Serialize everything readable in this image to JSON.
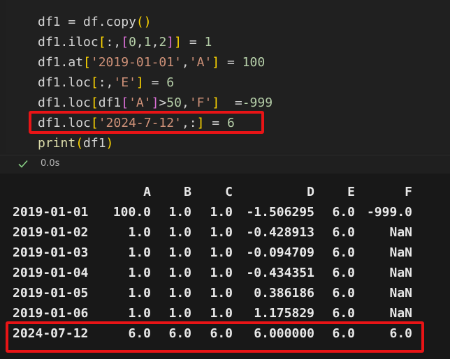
{
  "code": {
    "lines": [
      [
        [
          "df1",
          "tk-plain"
        ],
        [
          " = ",
          "tk-op"
        ],
        [
          "df",
          "tk-plain"
        ],
        [
          ".copy",
          "tk-plain"
        ],
        [
          "(",
          "tk-b1"
        ],
        [
          ")",
          "tk-b1"
        ]
      ],
      [
        [
          "df1",
          "tk-plain"
        ],
        [
          ".iloc",
          "tk-plain"
        ],
        [
          "[",
          "tk-b1"
        ],
        [
          ":,",
          "tk-plain"
        ],
        [
          "[",
          "tk-b2"
        ],
        [
          "0",
          "tk-num"
        ],
        [
          ",",
          "tk-plain"
        ],
        [
          "1",
          "tk-num"
        ],
        [
          ",",
          "tk-plain"
        ],
        [
          "2",
          "tk-num"
        ],
        [
          "]",
          "tk-b2"
        ],
        [
          "]",
          "tk-b1"
        ],
        [
          " = ",
          "tk-op"
        ],
        [
          "1",
          "tk-num"
        ]
      ],
      [
        [
          "df1",
          "tk-plain"
        ],
        [
          ".at",
          "tk-plain"
        ],
        [
          "[",
          "tk-b1"
        ],
        [
          "'2019-01-01'",
          "tk-str"
        ],
        [
          ",",
          "tk-plain"
        ],
        [
          "'A'",
          "tk-str"
        ],
        [
          "]",
          "tk-b1"
        ],
        [
          " = ",
          "tk-op"
        ],
        [
          "100",
          "tk-num"
        ]
      ],
      [
        [
          "df1",
          "tk-plain"
        ],
        [
          ".loc",
          "tk-plain"
        ],
        [
          "[",
          "tk-b1"
        ],
        [
          ":,",
          "tk-plain"
        ],
        [
          "'E'",
          "tk-str"
        ],
        [
          "]",
          "tk-b1"
        ],
        [
          " = ",
          "tk-op"
        ],
        [
          "6",
          "tk-num"
        ]
      ],
      [
        [
          "df1",
          "tk-plain"
        ],
        [
          ".loc",
          "tk-plain"
        ],
        [
          "[",
          "tk-b1"
        ],
        [
          "df1",
          "tk-plain"
        ],
        [
          "[",
          "tk-b2"
        ],
        [
          "'A'",
          "tk-str"
        ],
        [
          "]",
          "tk-b2"
        ],
        [
          ">",
          "tk-op"
        ],
        [
          "50",
          "tk-num"
        ],
        [
          ",",
          "tk-plain"
        ],
        [
          "'F'",
          "tk-str"
        ],
        [
          "]",
          "tk-b1"
        ],
        [
          "  =",
          "tk-op"
        ],
        [
          "-999",
          "tk-num"
        ]
      ],
      [
        [
          "df1",
          "tk-plain"
        ],
        [
          ".loc",
          "tk-plain"
        ],
        [
          "[",
          "tk-b1"
        ],
        [
          "'2024-7-12'",
          "tk-str"
        ],
        [
          ",:",
          "tk-plain"
        ],
        [
          "]",
          "tk-b1"
        ],
        [
          " = ",
          "tk-op"
        ],
        [
          "6",
          "tk-num"
        ]
      ],
      [
        [
          "print",
          "tk-fn"
        ],
        [
          "(",
          "tk-b1"
        ],
        [
          "df1",
          "tk-plain"
        ],
        [
          ")",
          "tk-b1"
        ]
      ]
    ]
  },
  "status": {
    "icon": "check-icon",
    "exec_time": "0.0s",
    "success_color": "#89d185"
  },
  "output": {
    "columns": [
      "A",
      "B",
      "C",
      "D",
      "E",
      "F"
    ],
    "rows": [
      {
        "index": "2019-01-01",
        "values": [
          "100.0",
          "1.0",
          "1.0",
          "-1.506295",
          "6.0",
          "-999.0"
        ]
      },
      {
        "index": "2019-01-02",
        "values": [
          "1.0",
          "1.0",
          "1.0",
          "-0.428913",
          "6.0",
          "NaN"
        ]
      },
      {
        "index": "2019-01-03",
        "values": [
          "1.0",
          "1.0",
          "1.0",
          "-0.094709",
          "6.0",
          "NaN"
        ]
      },
      {
        "index": "2019-01-04",
        "values": [
          "1.0",
          "1.0",
          "1.0",
          "-0.434351",
          "6.0",
          "NaN"
        ]
      },
      {
        "index": "2019-01-05",
        "values": [
          "1.0",
          "1.0",
          "1.0",
          "0.386186",
          "6.0",
          "NaN"
        ]
      },
      {
        "index": "2019-01-06",
        "values": [
          "1.0",
          "1.0",
          "1.0",
          "1.175829",
          "6.0",
          "NaN"
        ]
      },
      {
        "index": "2024-07-12",
        "values": [
          "6.0",
          "6.0",
          "6.0",
          "6.000000",
          "6.0",
          "6.0"
        ]
      }
    ]
  },
  "highlight_color": "#e81416"
}
